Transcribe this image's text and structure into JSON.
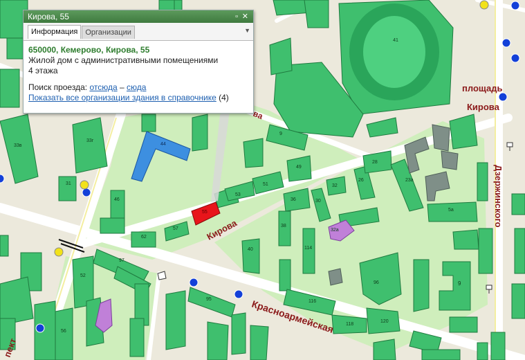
{
  "popup": {
    "title": "Кирова, 55",
    "tabs": [
      {
        "label": "Информация",
        "active": true
      },
      {
        "label": "Организации",
        "active": false
      }
    ],
    "address": "650000, Кемерово, Кирова, 55",
    "description": "Жилой дом с административными помещениями",
    "floors": "4 этажа",
    "route_label": "Поиск проезда:",
    "route_from": "отсюда",
    "route_dash": "–",
    "route_to": "сюда",
    "show_orgs_link": "Показать все организации здания в справочнике",
    "orgs_count": "(4)"
  },
  "map": {
    "street_labels": {
      "kirova": "Кирова",
      "krasnoarmeyskaya": "Красноармейская",
      "dzerzhinskogo": "Дзержинского",
      "ploshchad_1": "площадь",
      "ploshchad_2": "Кирова",
      "prospekt_fragment": "пект",
      "kirova_top_fragment": "ва"
    },
    "building_numbers": {
      "b41": "41",
      "b33v": "33в",
      "b33g": "33г",
      "b44": "44",
      "b46": "46",
      "b55": "55",
      "b57": "57",
      "b62": "62",
      "b53": "53",
      "b51": "51",
      "b49": "49",
      "b9": "9",
      "b36": "36",
      "b38": "38",
      "b40": "40",
      "b30": "30",
      "b32": "32",
      "b32a": "32а",
      "b28": "28",
      "b23a": "23а",
      "b5a": "5а",
      "b26": "26",
      "b114": "114",
      "b96": "96",
      "b116": "116",
      "b118": "118",
      "b120": "120",
      "b95": "95",
      "b97": "97",
      "b52": "52",
      "b56": "56",
      "b31": "31"
    },
    "colors": {
      "background": "#ece9dc",
      "park": "#cfeebc",
      "road": "#ffffff",
      "building": "#3fbf6e",
      "building_dark": "#1f8f48",
      "selected_building": "#e8151b",
      "blue_building": "#3d8fe0",
      "purple_building": "#c080d8",
      "stop_blue": "#1340d8",
      "stop_yellow": "#f2e21a",
      "label_red": "#8b1a1a"
    }
  }
}
